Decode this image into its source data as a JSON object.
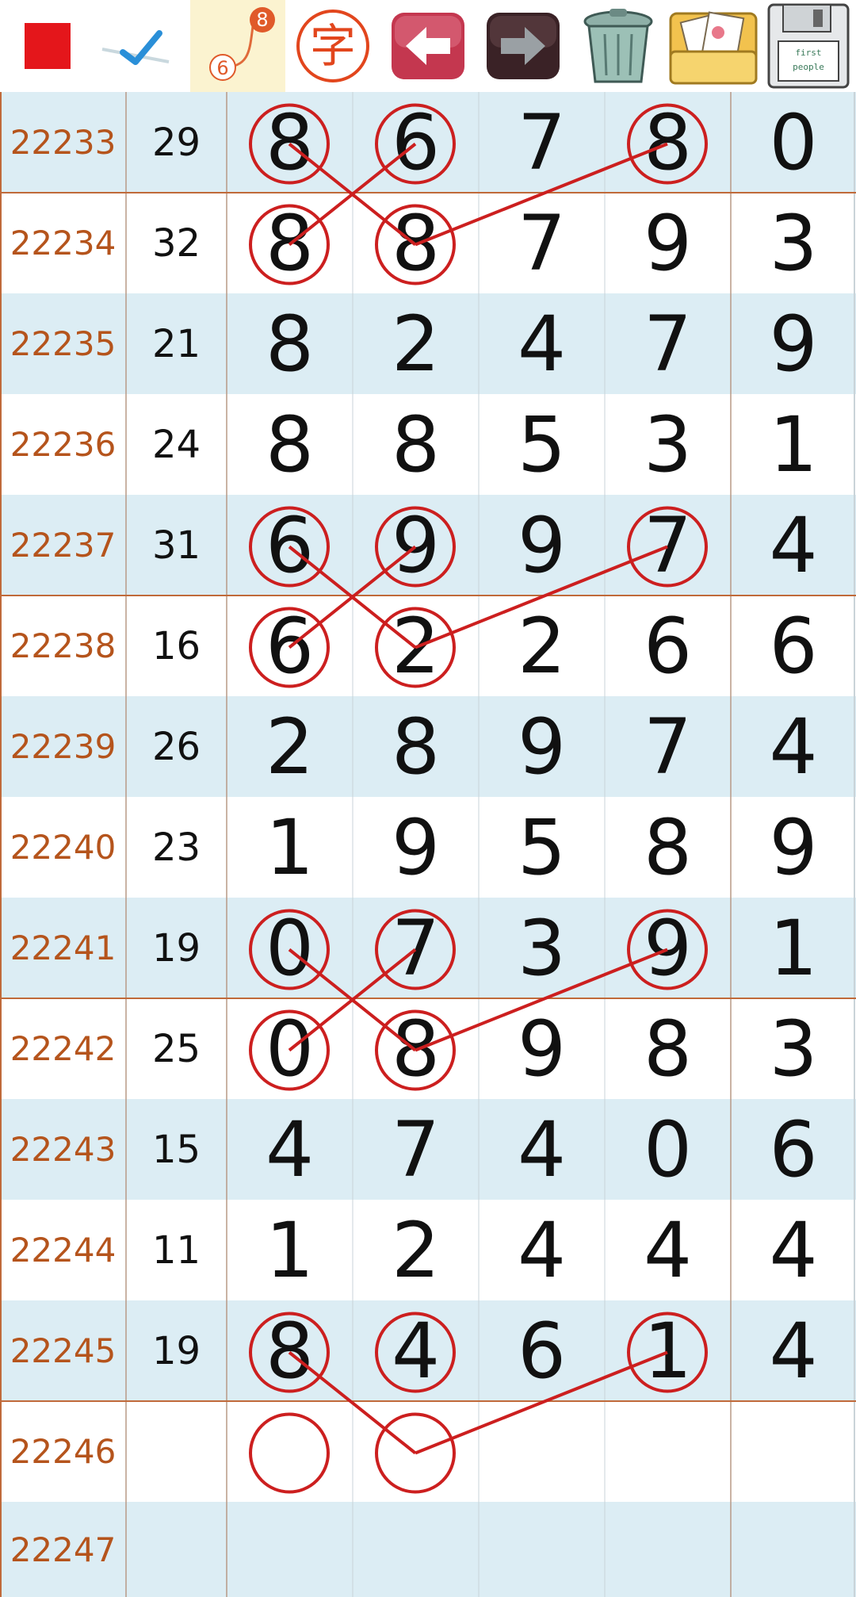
{
  "toolbar": {
    "tools": [
      {
        "name": "red-square-tool",
        "icon": "red-square-icon"
      },
      {
        "name": "check-tool",
        "icon": "checkmark-icon"
      },
      {
        "name": "link-number-tool",
        "icon": "link-numbers-icon",
        "num_a": "8",
        "num_b": "6"
      },
      {
        "name": "text-tool",
        "icon": "char-stamp-icon",
        "glyph": "字"
      },
      {
        "name": "back-tool",
        "icon": "arrow-left-icon"
      },
      {
        "name": "forward-tool",
        "icon": "arrow-right-icon"
      },
      {
        "name": "trash-tool",
        "icon": "trash-can-icon"
      },
      {
        "name": "photos-tool",
        "icon": "photo-folder-icon"
      },
      {
        "name": "save-tool",
        "icon": "floppy-disk-icon",
        "label_1": "first",
        "label_2": "people"
      }
    ]
  },
  "colors": {
    "row_band": "#dcedf4",
    "row_plain": "#ffffff",
    "issue_text": "#b5541c",
    "mark_red": "#cc1f1f",
    "group_border": "#c06a3a",
    "grid_line": "#c9d3d8",
    "highlight_cell": "#fbf3d0"
  },
  "rows": [
    {
      "issue": "22233",
      "sum": "29",
      "digits": [
        "8",
        "6",
        "7",
        "8",
        "0"
      ],
      "circled": [
        0,
        1,
        3
      ]
    },
    {
      "issue": "22234",
      "sum": "32",
      "digits": [
        "8",
        "8",
        "7",
        "9",
        "3"
      ],
      "circled": [
        0,
        1
      ]
    },
    {
      "issue": "22235",
      "sum": "21",
      "digits": [
        "8",
        "2",
        "4",
        "7",
        "9"
      ],
      "circled": []
    },
    {
      "issue": "22236",
      "sum": "24",
      "digits": [
        "8",
        "8",
        "5",
        "3",
        "1"
      ],
      "circled": []
    },
    {
      "issue": "22237",
      "sum": "31",
      "digits": [
        "6",
        "9",
        "9",
        "7",
        "4"
      ],
      "circled": [
        0,
        1,
        3
      ]
    },
    {
      "issue": "22238",
      "sum": "16",
      "digits": [
        "6",
        "2",
        "2",
        "6",
        "6"
      ],
      "circled": [
        0,
        1
      ]
    },
    {
      "issue": "22239",
      "sum": "26",
      "digits": [
        "2",
        "8",
        "9",
        "7",
        "4"
      ],
      "circled": []
    },
    {
      "issue": "22240",
      "sum": "23",
      "digits": [
        "1",
        "9",
        "5",
        "8",
        "9"
      ],
      "circled": []
    },
    {
      "issue": "22241",
      "sum": "19",
      "digits": [
        "0",
        "7",
        "3",
        "9",
        "1"
      ],
      "circled": [
        0,
        1,
        3
      ]
    },
    {
      "issue": "22242",
      "sum": "25",
      "digits": [
        "0",
        "8",
        "9",
        "8",
        "3"
      ],
      "circled": [
        0,
        1
      ]
    },
    {
      "issue": "22243",
      "sum": "15",
      "digits": [
        "4",
        "7",
        "4",
        "0",
        "6"
      ],
      "circled": []
    },
    {
      "issue": "22244",
      "sum": "11",
      "digits": [
        "1",
        "2",
        "4",
        "4",
        "4"
      ],
      "circled": []
    },
    {
      "issue": "22245",
      "sum": "19",
      "digits": [
        "8",
        "4",
        "6",
        "1",
        "4"
      ],
      "circled": [
        0,
        1,
        3
      ]
    },
    {
      "issue": "22246",
      "sum": "",
      "digits": [
        "",
        "",
        "",
        "",
        ""
      ],
      "circled": [
        0,
        1
      ]
    },
    {
      "issue": "22247",
      "sum": "",
      "digits": [
        "",
        "",
        "",
        "",
        ""
      ],
      "circled": []
    }
  ],
  "marks": {
    "group_separator_after_rows": [
      0,
      4,
      8,
      12
    ],
    "connections": [
      {
        "from": [
          0,
          0
        ],
        "to": [
          1,
          1
        ]
      },
      {
        "from": [
          0,
          1
        ],
        "to": [
          1,
          0
        ]
      },
      {
        "from": [
          0,
          3
        ],
        "to": [
          1,
          1
        ]
      },
      {
        "from": [
          4,
          0
        ],
        "to": [
          5,
          1
        ]
      },
      {
        "from": [
          4,
          1
        ],
        "to": [
          5,
          0
        ]
      },
      {
        "from": [
          4,
          3
        ],
        "to": [
          5,
          1
        ]
      },
      {
        "from": [
          8,
          0
        ],
        "to": [
          9,
          1
        ]
      },
      {
        "from": [
          8,
          1
        ],
        "to": [
          9,
          0
        ]
      },
      {
        "from": [
          8,
          3
        ],
        "to": [
          9,
          1
        ]
      },
      {
        "from": [
          12,
          0
        ],
        "to": [
          13,
          1
        ]
      },
      {
        "from": [
          12,
          3
        ],
        "to": [
          13,
          1
        ]
      }
    ]
  }
}
